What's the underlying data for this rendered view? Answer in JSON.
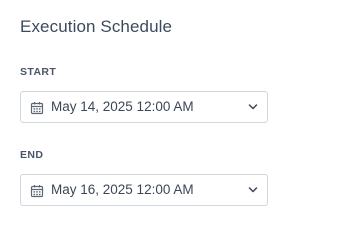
{
  "section": {
    "title": "Execution Schedule"
  },
  "start": {
    "label": "START",
    "value": "May 14, 2025 12:00 AM",
    "icon": "calendar-icon"
  },
  "end": {
    "label": "END",
    "value": "May 16, 2025 12:00 AM",
    "icon": "calendar-icon"
  },
  "colors": {
    "text": "#3b4656",
    "border": "#d2d7de",
    "background": "#ffffff"
  }
}
